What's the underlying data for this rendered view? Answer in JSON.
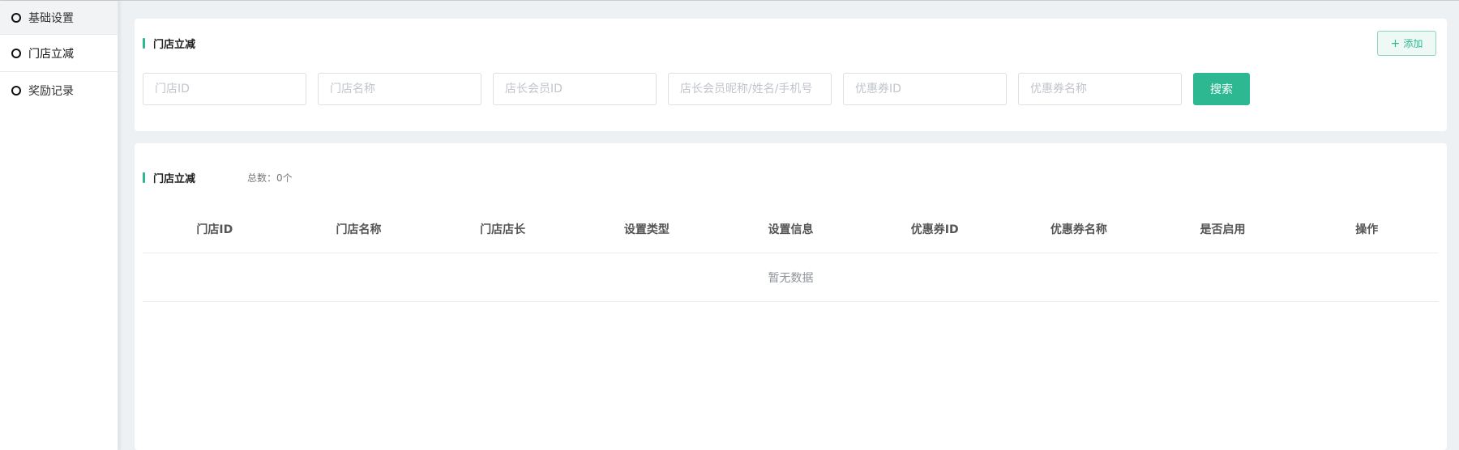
{
  "sidebar": {
    "items": [
      {
        "label": "基础设置"
      },
      {
        "label": "门店立减"
      },
      {
        "label": "奖励记录"
      }
    ]
  },
  "filter_section": {
    "title": "门店立减",
    "add_label": "添加",
    "inputs": [
      {
        "placeholder": "门店ID",
        "value": ""
      },
      {
        "placeholder": "门店名称",
        "value": ""
      },
      {
        "placeholder": "店长会员ID",
        "value": ""
      },
      {
        "placeholder": "店长会员昵称/姓名/手机号",
        "value": ""
      },
      {
        "placeholder": "优惠券ID",
        "value": ""
      },
      {
        "placeholder": "优惠券名称",
        "value": ""
      }
    ],
    "search_label": "搜索"
  },
  "list_section": {
    "title": "门店立减",
    "total_label": "总数：0个",
    "columns": [
      "门店ID",
      "门店名称",
      "门店店长",
      "设置类型",
      "设置信息",
      "优惠券ID",
      "优惠券名称",
      "是否启用",
      "操作"
    ],
    "empty_text": "暂无数据"
  },
  "colors": {
    "accent": "#2db891",
    "background": "#eef1f4"
  }
}
